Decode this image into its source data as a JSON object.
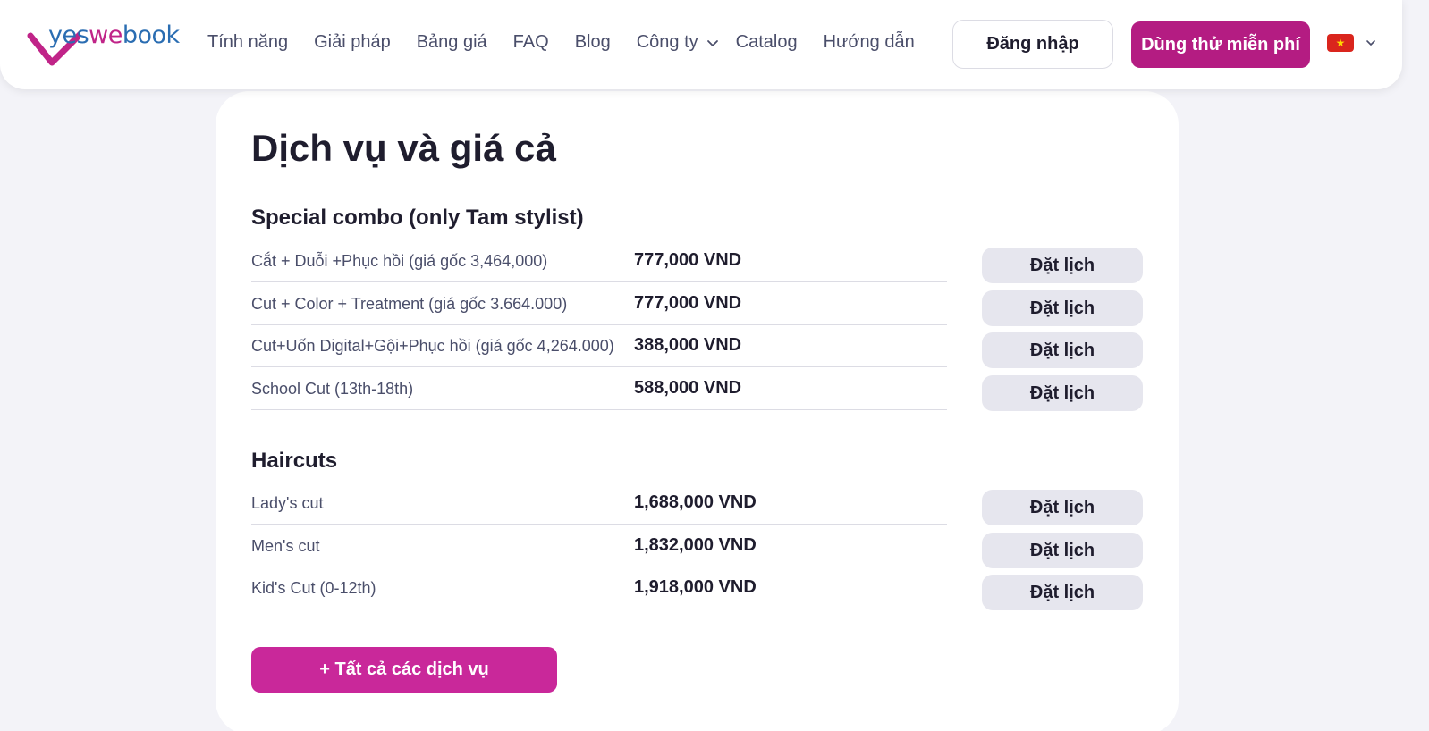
{
  "brand": {
    "logo_text_part1": "yes",
    "logo_text_part2": "we",
    "logo_text_part3": "book",
    "primary_color": "#b41c82",
    "accent_color": "#2a6db2"
  },
  "nav": {
    "items": [
      {
        "label": "Tính năng"
      },
      {
        "label": "Giải pháp"
      },
      {
        "label": "Bảng giá"
      },
      {
        "label": "FAQ"
      },
      {
        "label": "Blog"
      },
      {
        "label": "Công ty",
        "has_dropdown": true
      },
      {
        "label": "Catalog"
      },
      {
        "label": "Hướng dẫn"
      }
    ],
    "login_label": "Đăng nhập",
    "trial_label": "Dùng thử miễn phí",
    "language_flag": "vn-flag-icon"
  },
  "main": {
    "title": "Dịch vụ và giá cả",
    "book_label": "Đặt lịch",
    "sections": [
      {
        "title": "Special combo (only Tam stylist)",
        "items": [
          {
            "name": "Cắt + Duỗi +Phục hồi (giá gốc 3,464,000)",
            "price": "777,000 VND"
          },
          {
            "name": "Cut + Color + Treatment (giá gốc 3.664.000)",
            "price": "777,000 VND"
          },
          {
            "name": "Cut+Uốn Digital+Gội+Phục hồi (giá gốc 4,264.000)",
            "price": "388,000 VND"
          },
          {
            "name": "School Cut (13th-18th)",
            "price": "588,000 VND"
          }
        ]
      },
      {
        "title": "Haircuts",
        "items": [
          {
            "name": "Lady's cut",
            "price": "1,688,000 VND"
          },
          {
            "name": "Men's cut",
            "price": "1,832,000 VND"
          },
          {
            "name": "Kid's Cut (0-12th)",
            "price": "1,918,000 VND"
          }
        ]
      }
    ],
    "all_services_label": "+ Tất cả các dịch vụ"
  }
}
